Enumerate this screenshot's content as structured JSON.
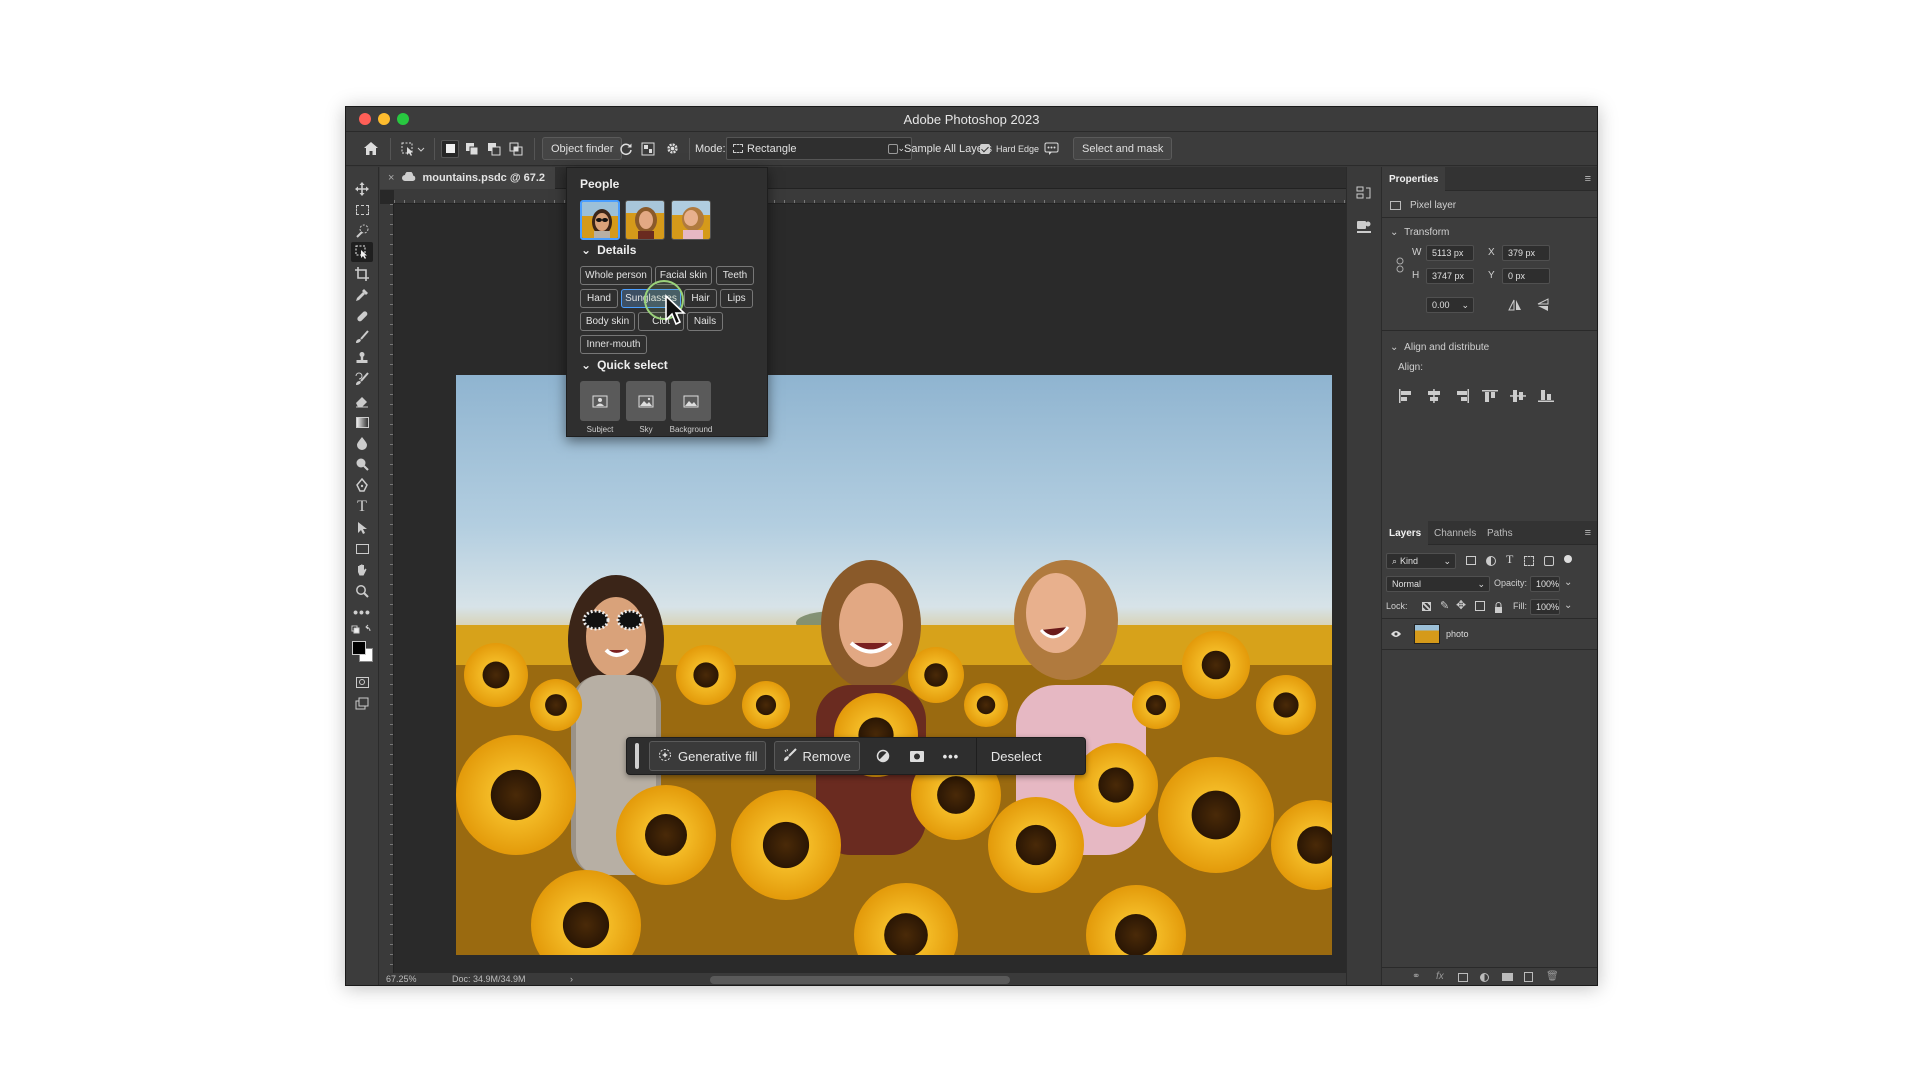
{
  "window": {
    "title": "Adobe Photoshop 2023"
  },
  "options_bar": {
    "object_finder_label": "Object finder",
    "mode_label": "Mode:",
    "mode_value": "Rectangle",
    "sample_all_layers_label": "Sample All Layers",
    "hard_edge_label": "Hard Edge",
    "select_and_mask_label": "Select and mask",
    "sample_all_layers_checked": false,
    "hard_edge_checked": true
  },
  "document_tab": {
    "label": "mountains.psdc @ 67.2"
  },
  "status_bar": {
    "zoom": "67.25%",
    "doc_size": "Doc: 34.9M/34.9M"
  },
  "object_finder": {
    "people_heading": "People",
    "details_heading": "Details",
    "details_chips": [
      "Whole person",
      "Facial skin",
      "Teeth",
      "Hand",
      "Sunglasses",
      "Hair",
      "Lips",
      "Body skin",
      "Clot",
      "Nails",
      "Inner-mouth"
    ],
    "highlighted_chip": "Sunglasses",
    "quick_select_heading": "Quick select",
    "quick_select": [
      "Subject",
      "Sky",
      "Background"
    ]
  },
  "taskbar": {
    "generative_fill_label": "Generative fill",
    "remove_label": "Remove",
    "deselect_label": "Deselect"
  },
  "properties_panel": {
    "tab_label": "Properties",
    "layer_type": "Pixel layer",
    "transform_heading": "Transform",
    "w_label": "W",
    "w_value": "5113 px",
    "h_label": "H",
    "h_value": "3747 px",
    "x_label": "X",
    "x_value": "379 px",
    "y_label": "Y",
    "y_value": "0 px",
    "angle_value": "0.00",
    "align_heading": "Align and distribute",
    "align_label": "Align:"
  },
  "layers_panel": {
    "tabs": [
      "Layers",
      "Channels",
      "Paths"
    ],
    "kind_label": "Kind",
    "blend_mode": "Normal",
    "opacity_label": "Opacity:",
    "opacity_value": "100%",
    "lock_label": "Lock:",
    "fill_label": "Fill:",
    "fill_value": "100%",
    "layers": [
      {
        "name": "photo",
        "visible": true
      }
    ]
  },
  "colors": {
    "accent": "#4a9eff",
    "chrome": "#3c3c3c",
    "canvas": "#282828"
  }
}
